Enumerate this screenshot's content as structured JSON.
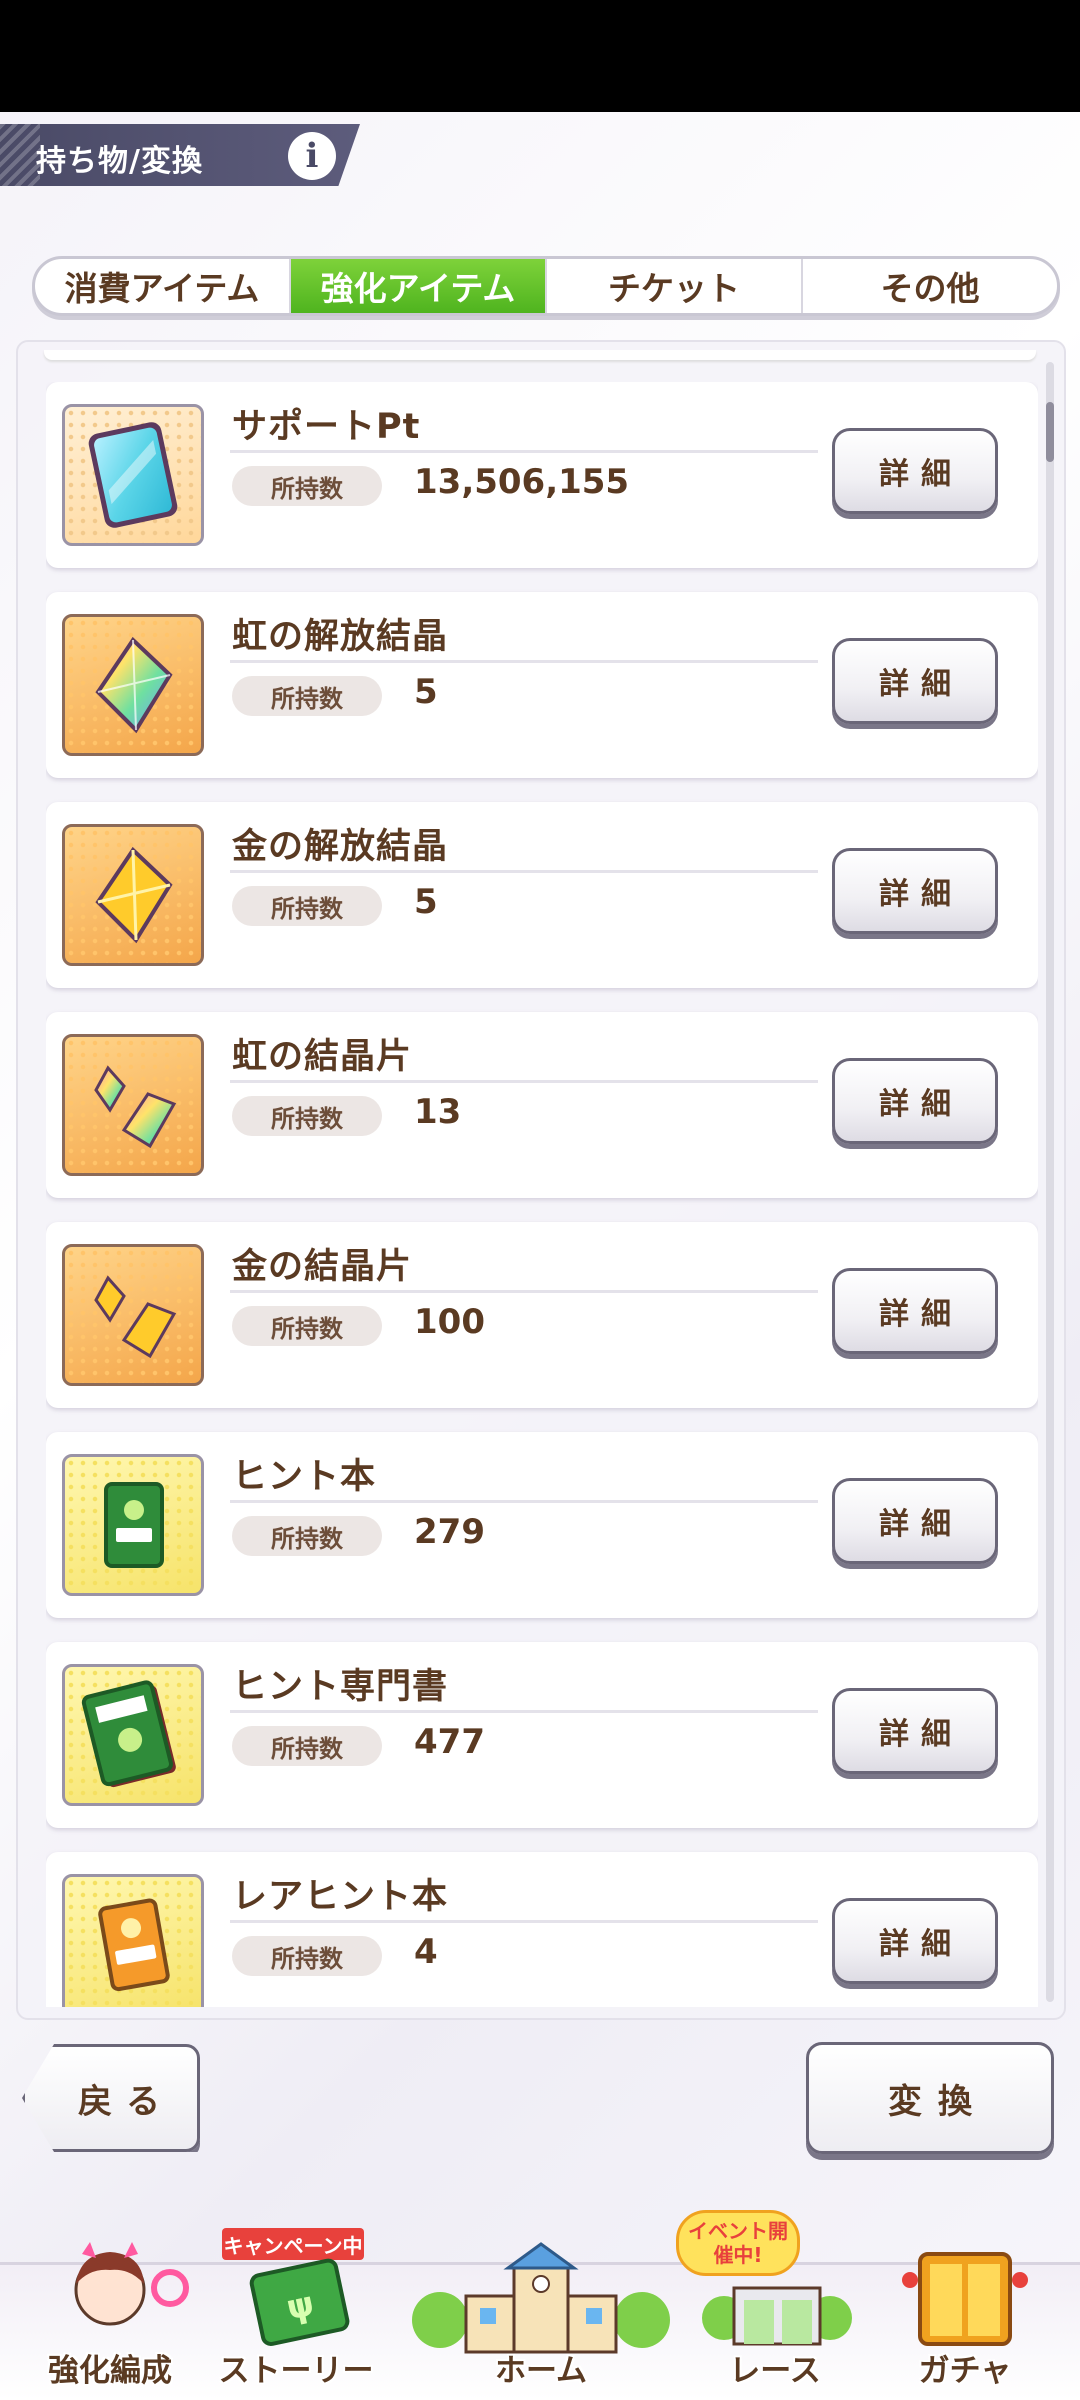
{
  "header": {
    "title": "持ち物/変換",
    "info_icon": "i"
  },
  "tabs": [
    {
      "label": "消費アイテム",
      "active": false
    },
    {
      "label": "強化アイテム",
      "active": true
    },
    {
      "label": "チケット",
      "active": false
    },
    {
      "label": "その他",
      "active": false
    }
  ],
  "items": [
    {
      "name": "サポートPt",
      "own_label": "所持数",
      "count": "13,506,155",
      "detail_label": "詳細",
      "icon": "support-pt-card-icon"
    },
    {
      "name": "虹の解放結晶",
      "own_label": "所持数",
      "count": "5",
      "detail_label": "詳細",
      "icon": "rainbow-crystal-icon"
    },
    {
      "name": "金の解放結晶",
      "own_label": "所持数",
      "count": "5",
      "detail_label": "詳細",
      "icon": "gold-crystal-icon"
    },
    {
      "name": "虹の結晶片",
      "own_label": "所持数",
      "count": "13",
      "detail_label": "詳細",
      "icon": "rainbow-shard-icon"
    },
    {
      "name": "金の結晶片",
      "own_label": "所持数",
      "count": "100",
      "detail_label": "詳細",
      "icon": "gold-shard-icon"
    },
    {
      "name": "ヒント本",
      "own_label": "所持数",
      "count": "279",
      "detail_label": "詳細",
      "icon": "hint-book-icon"
    },
    {
      "name": "ヒント専門書",
      "own_label": "所持数",
      "count": "477",
      "detail_label": "詳細",
      "icon": "hint-special-book-icon"
    },
    {
      "name": "レアヒント本",
      "own_label": "所持数",
      "count": "4",
      "detail_label": "詳細",
      "icon": "rare-hint-book-icon"
    }
  ],
  "buttons": {
    "back": "戻る",
    "convert": "変換"
  },
  "nav": {
    "items": [
      {
        "label": "強化編成"
      },
      {
        "label": "ストーリー"
      },
      {
        "label": "ホーム"
      },
      {
        "label": "レース"
      },
      {
        "label": "ガチャ"
      }
    ],
    "campaign_badge": "キャンペーン中",
    "event_badge": "イベント開催中!"
  },
  "colors": {
    "active_tab": "#5cbf27",
    "text_brown": "#5a3a22",
    "title_plate": "#4a4a66"
  }
}
